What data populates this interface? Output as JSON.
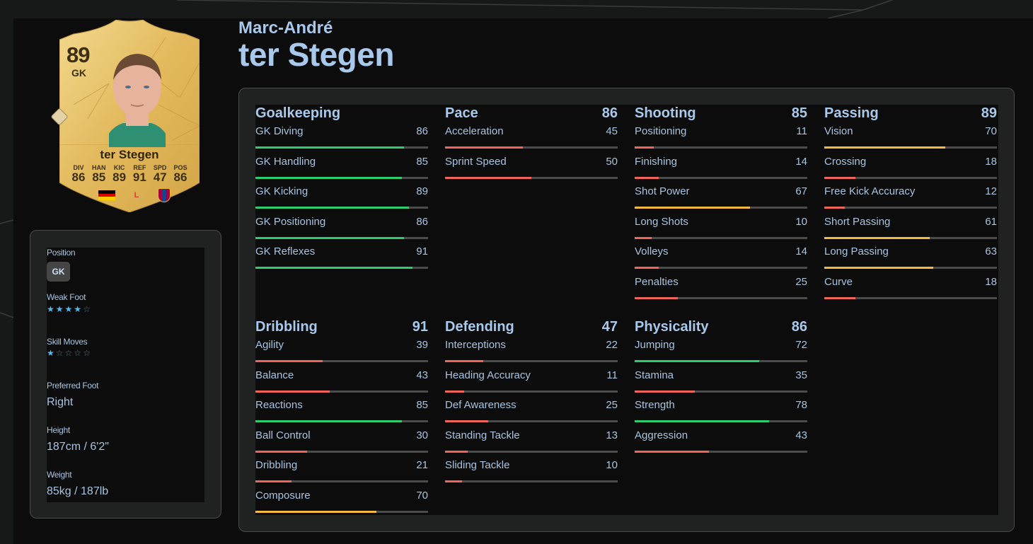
{
  "player": {
    "first_name": "Marc-André",
    "last_name": "ter Stegen"
  },
  "card": {
    "overall": "89",
    "position": "GK",
    "name": "ter Stegen",
    "stats": [
      {
        "label": "DIV",
        "value": "86"
      },
      {
        "label": "HAN",
        "value": "85"
      },
      {
        "label": "KIC",
        "value": "89"
      },
      {
        "label": "REF",
        "value": "91"
      },
      {
        "label": "SPD",
        "value": "47"
      },
      {
        "label": "POS",
        "value": "86"
      }
    ],
    "nation": "germany-flag",
    "league": "laliga-logo",
    "club": "fc-barcelona-crest"
  },
  "info": {
    "position_label": "Position",
    "position_value": "GK",
    "weak_foot_label": "Weak Foot",
    "weak_foot_stars": 4,
    "skill_moves_label": "Skill Moves",
    "skill_moves_stars": 1,
    "max_stars": 5,
    "preferred_foot_label": "Preferred Foot",
    "preferred_foot_value": "Right",
    "height_label": "Height",
    "height_value": "187cm / 6'2\"",
    "weight_label": "Weight",
    "weight_value": "85kg / 187lb"
  },
  "colors": {
    "high": "#2ecc71",
    "mid": "#f5b942",
    "low": "#f0645a",
    "track": "#4b4b4b",
    "accent_text": "#a9c9ec"
  },
  "groups": [
    {
      "title": "Goalkeeping",
      "total": "",
      "attrs": [
        {
          "name": "GK Diving",
          "value": 86
        },
        {
          "name": "GK Handling",
          "value": 85
        },
        {
          "name": "GK Kicking",
          "value": 89
        },
        {
          "name": "GK Positioning",
          "value": 86
        },
        {
          "name": "GK Reflexes",
          "value": 91
        }
      ]
    },
    {
      "title": "Pace",
      "total": "86",
      "attrs": [
        {
          "name": "Acceleration",
          "value": 45
        },
        {
          "name": "Sprint Speed",
          "value": 50
        }
      ]
    },
    {
      "title": "Shooting",
      "total": "85",
      "attrs": [
        {
          "name": "Positioning",
          "value": 11
        },
        {
          "name": "Finishing",
          "value": 14
        },
        {
          "name": "Shot Power",
          "value": 67
        },
        {
          "name": "Long Shots",
          "value": 10
        },
        {
          "name": "Volleys",
          "value": 14
        },
        {
          "name": "Penalties",
          "value": 25
        }
      ]
    },
    {
      "title": "Passing",
      "total": "89",
      "attrs": [
        {
          "name": "Vision",
          "value": 70
        },
        {
          "name": "Crossing",
          "value": 18
        },
        {
          "name": "Free Kick Accuracy",
          "value": 12
        },
        {
          "name": "Short Passing",
          "value": 61
        },
        {
          "name": "Long Passing",
          "value": 63
        },
        {
          "name": "Curve",
          "value": 18
        }
      ]
    },
    {
      "title": "Dribbling",
      "total": "91",
      "attrs": [
        {
          "name": "Agility",
          "value": 39
        },
        {
          "name": "Balance",
          "value": 43
        },
        {
          "name": "Reactions",
          "value": 85
        },
        {
          "name": "Ball Control",
          "value": 30
        },
        {
          "name": "Dribbling",
          "value": 21
        },
        {
          "name": "Composure",
          "value": 70
        }
      ]
    },
    {
      "title": "Defending",
      "total": "47",
      "attrs": [
        {
          "name": "Interceptions",
          "value": 22
        },
        {
          "name": "Heading Accuracy",
          "value": 11
        },
        {
          "name": "Def Awareness",
          "value": 25
        },
        {
          "name": "Standing Tackle",
          "value": 13
        },
        {
          "name": "Sliding Tackle",
          "value": 10
        }
      ]
    },
    {
      "title": "Physicality",
      "total": "86",
      "attrs": [
        {
          "name": "Jumping",
          "value": 72
        },
        {
          "name": "Stamina",
          "value": 35
        },
        {
          "name": "Strength",
          "value": 78
        },
        {
          "name": "Aggression",
          "value": 43
        }
      ]
    }
  ]
}
